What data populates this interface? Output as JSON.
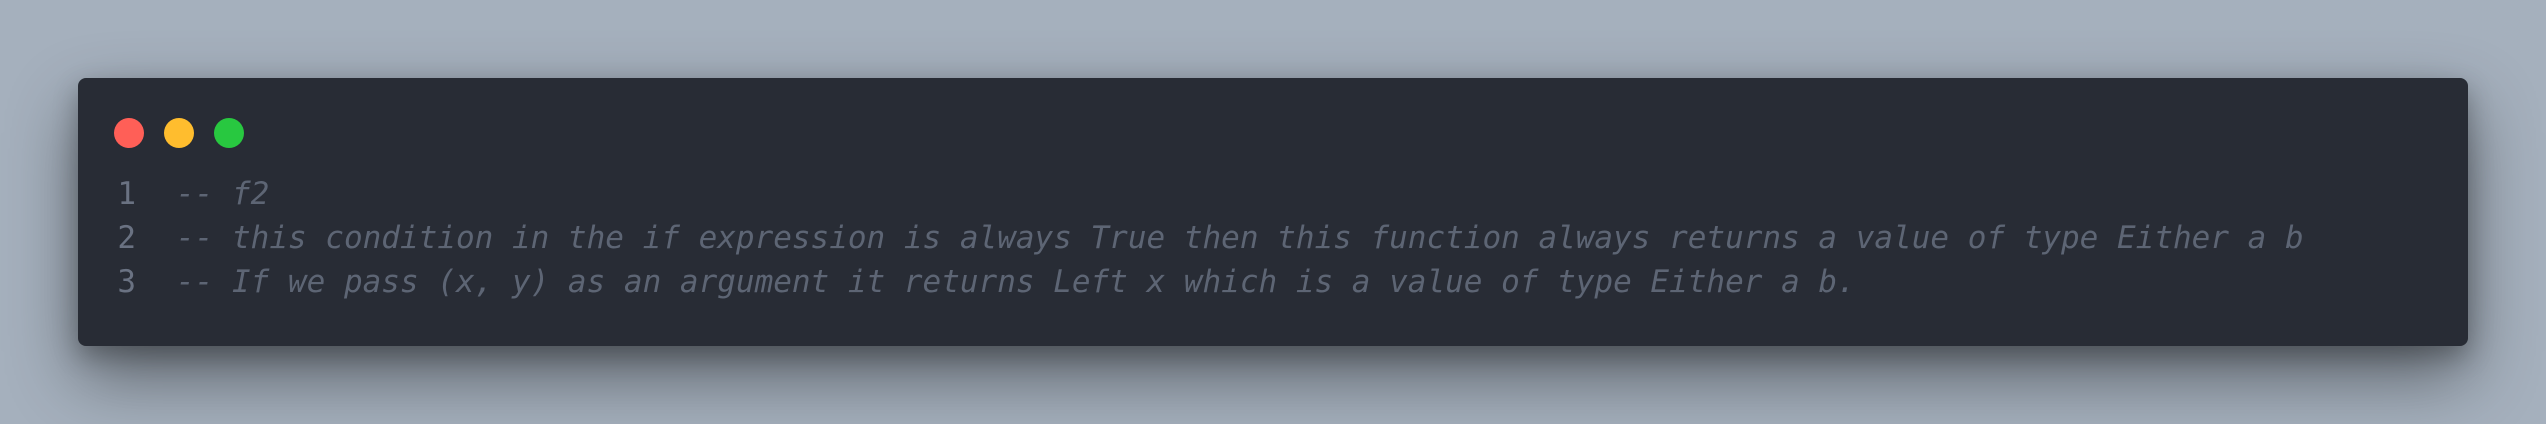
{
  "colors": {
    "background": "#a5b0bd",
    "window": "#282c35",
    "close": "#ff5f57",
    "minimize": "#ffbd2e",
    "maximize": "#28c840",
    "comment": "#5d6574",
    "line_number": "#6a7282"
  },
  "window_controls": [
    {
      "name": "close-dot-icon"
    },
    {
      "name": "minimize-dot-icon"
    },
    {
      "name": "maximize-dot-icon"
    }
  ],
  "code": {
    "lines": [
      {
        "number": "1",
        "text": "-- f2"
      },
      {
        "number": "2",
        "text": "-- this condition in the if expression is always True then this function always returns a value of type Either a b"
      },
      {
        "number": "3",
        "text": "-- If we pass (x, y) as an argument it returns Left x which is a value of type Either a b."
      }
    ]
  }
}
